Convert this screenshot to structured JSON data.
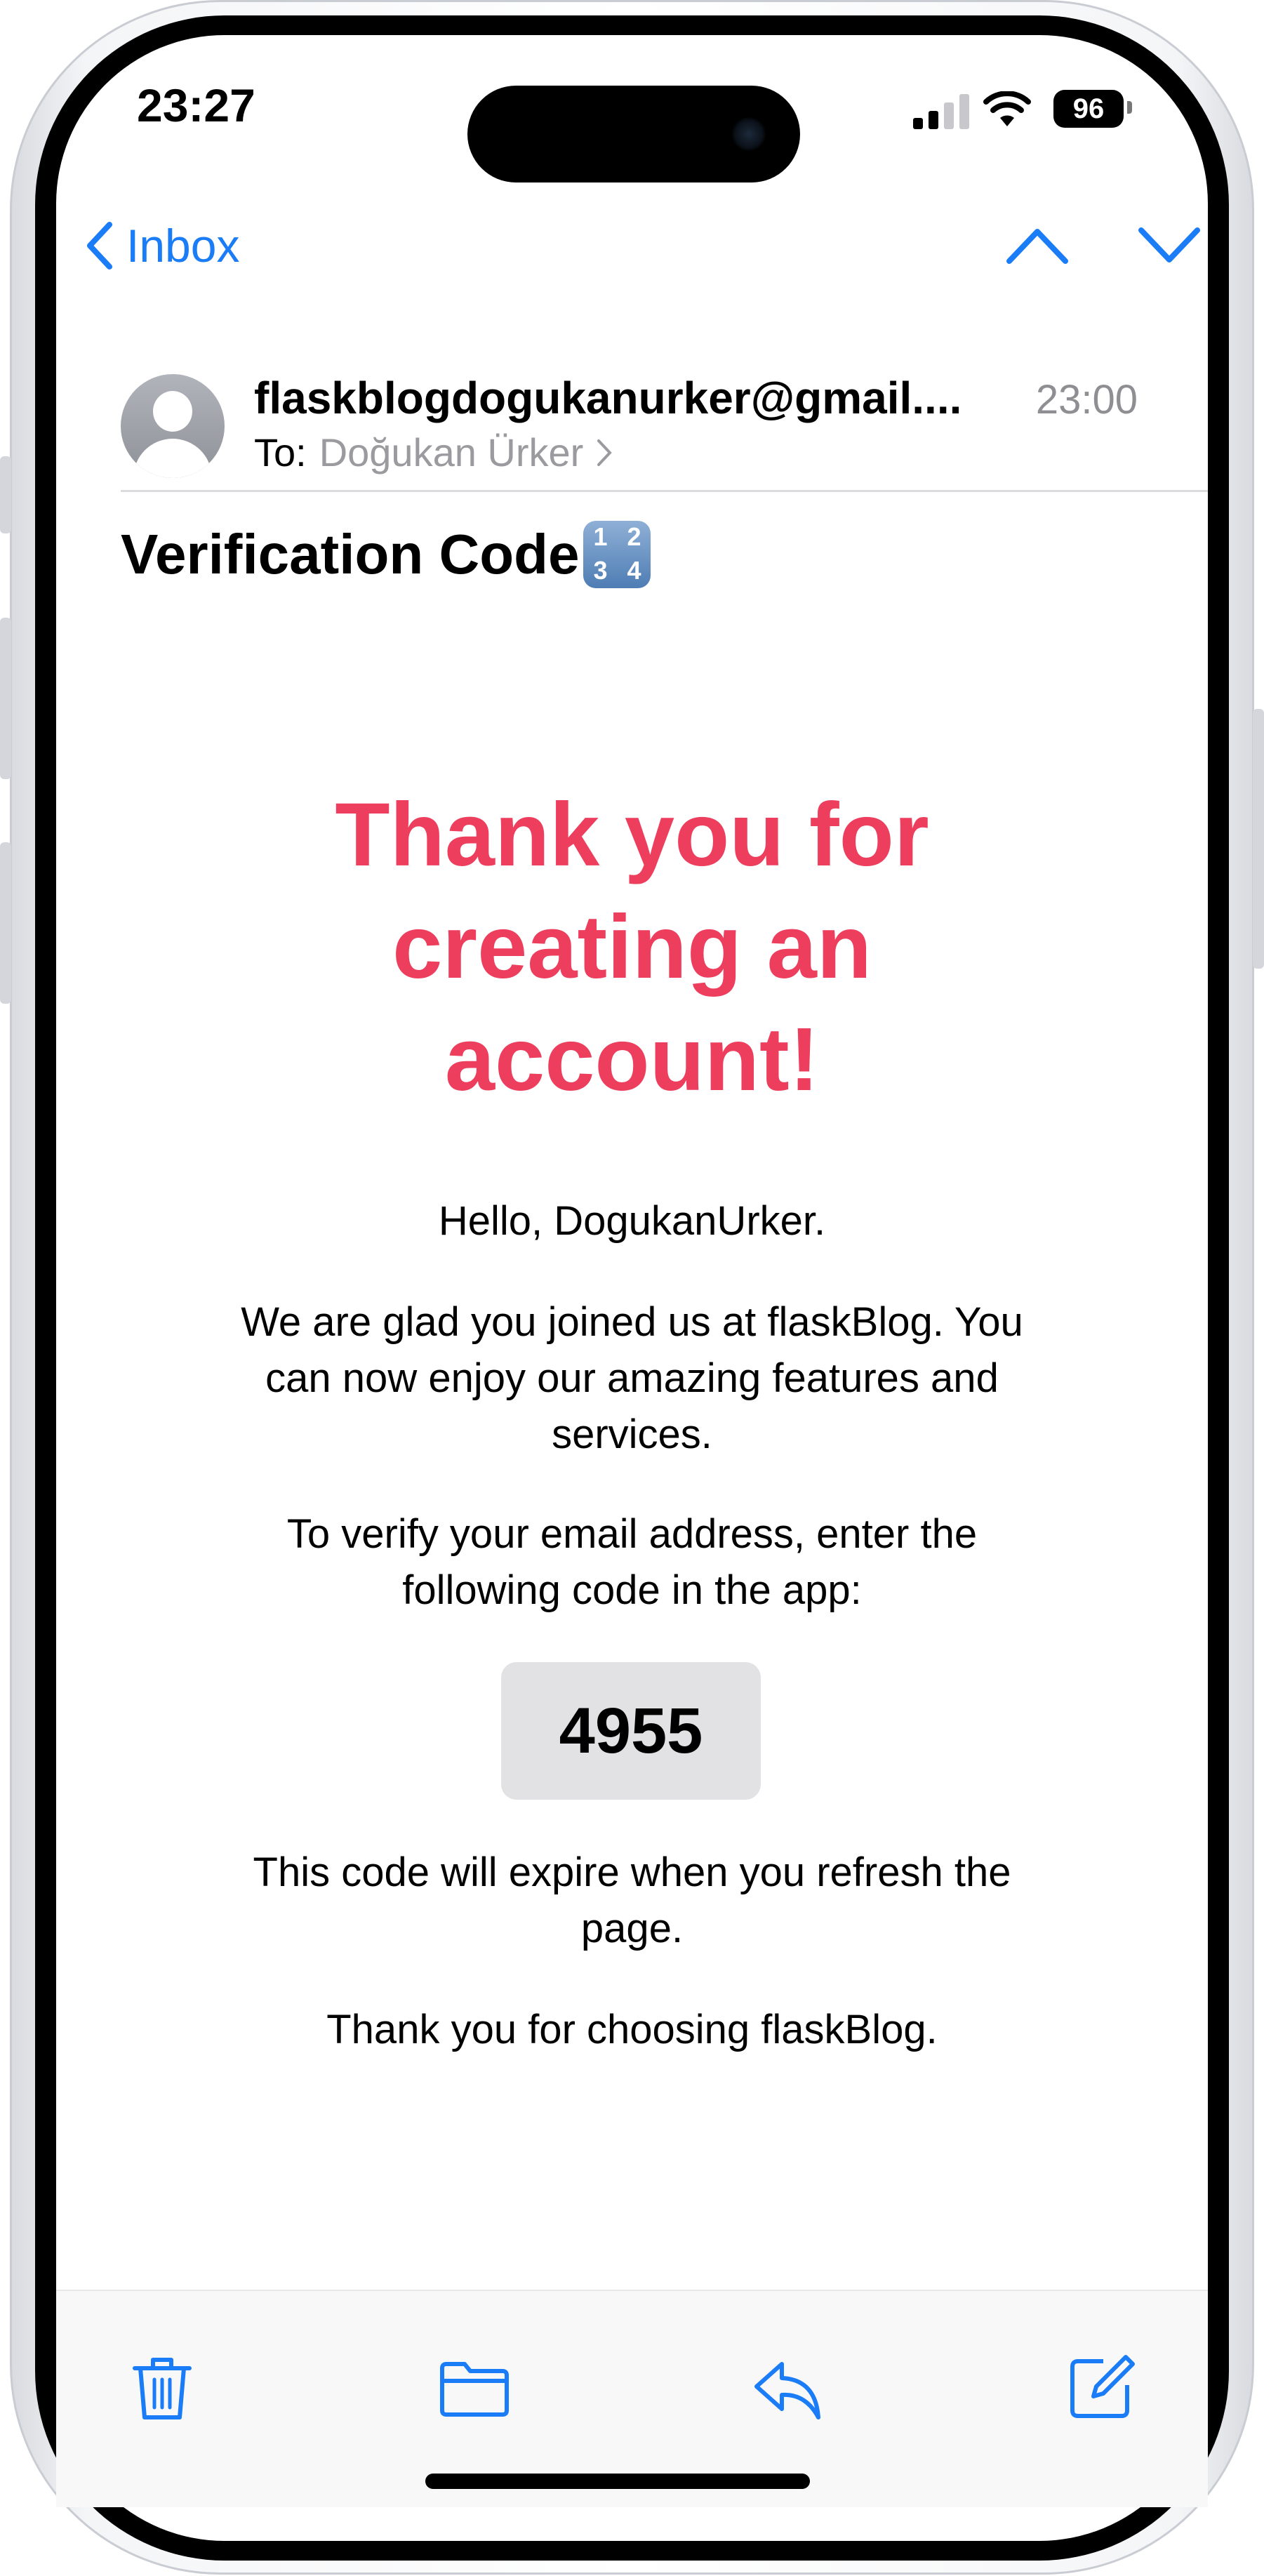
{
  "status_bar": {
    "time": "23:27",
    "battery_level": "96"
  },
  "nav": {
    "back_label": "Inbox"
  },
  "message": {
    "sender": "flaskblogdogukanurker@gmail....",
    "received_time": "23:00",
    "to_prefix": "To:",
    "to_name": "Doğukan Ürker",
    "subject": "Verification Code",
    "subject_emoji": [
      "1",
      "2",
      "3",
      "4"
    ]
  },
  "email_body": {
    "headline_lines": [
      "Thank you for",
      "creating an",
      "account!"
    ],
    "greeting": "Hello, DogukanUrker.",
    "welcome_lines": [
      "We are glad you joined us at flaskBlog. You",
      "can now enjoy our amazing features and",
      "services."
    ],
    "verify_lines": [
      "To verify your email address, enter the",
      "following code in the app:"
    ],
    "code": "4955",
    "expire_lines": [
      "This code will expire when you refresh the",
      "page."
    ],
    "closing": "Thank you for choosing flaskBlog."
  },
  "colors": {
    "accent_blue": "#1a7cf6",
    "headline_red": "#ed3e5e",
    "code_box_bg": "#e2e2e4"
  },
  "toolbar": {
    "icons": [
      "trash-icon",
      "folder-icon",
      "reply-icon",
      "compose-icon"
    ]
  }
}
